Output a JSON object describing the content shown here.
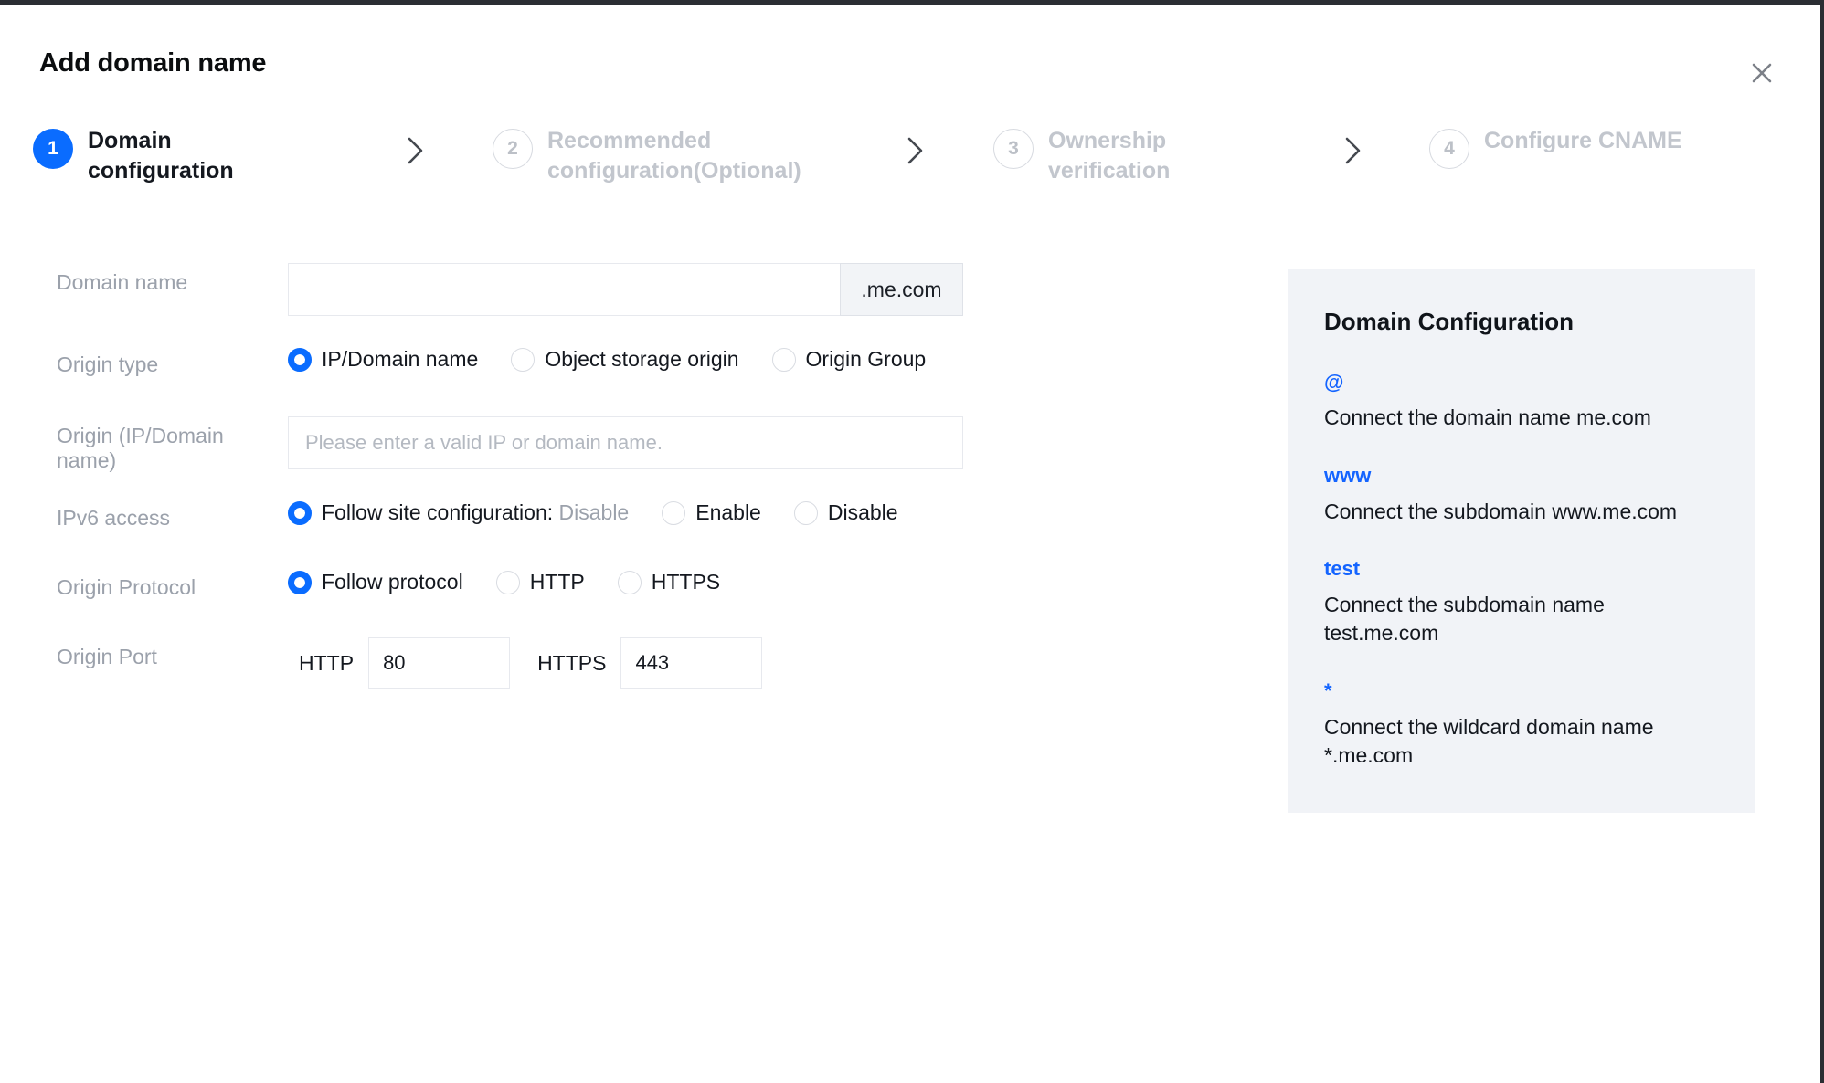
{
  "dialog": {
    "title": "Add domain name",
    "close_icon": "close-icon"
  },
  "stepper": {
    "steps": [
      {
        "number": "1",
        "label": "Domain configuration",
        "state": "active"
      },
      {
        "number": "2",
        "label": "Recommended configuration(Optional)",
        "state": "inactive"
      },
      {
        "number": "3",
        "label": "Ownership verification",
        "state": "inactive"
      },
      {
        "number": "4",
        "label": "Configure CNAME",
        "state": "inactive"
      }
    ],
    "separator_icon": "chevron-right-icon"
  },
  "form": {
    "domain_name": {
      "label": "Domain name",
      "value": "",
      "placeholder": "",
      "suffix": ".me.com"
    },
    "origin_type": {
      "label": "Origin type",
      "options": [
        {
          "label": "IP/Domain name",
          "selected": true
        },
        {
          "label": "Object storage origin",
          "selected": false
        },
        {
          "label": "Origin Group",
          "selected": false
        }
      ]
    },
    "origin_address": {
      "label": "Origin (IP/Domain name)",
      "value": "",
      "placeholder": "Please enter a valid IP or domain name."
    },
    "ipv6_access": {
      "label": "IPv6 access",
      "options": [
        {
          "label": "Follow site configuration:",
          "suffix": "Disable",
          "selected": true
        },
        {
          "label": "Enable",
          "selected": false
        },
        {
          "label": "Disable",
          "selected": false
        }
      ]
    },
    "origin_protocol": {
      "label": "Origin Protocol",
      "options": [
        {
          "label": "Follow protocol",
          "selected": true
        },
        {
          "label": "HTTP",
          "selected": false
        },
        {
          "label": "HTTPS",
          "selected": false
        }
      ]
    },
    "origin_port": {
      "label": "Origin Port",
      "http_label": "HTTP",
      "http_value": "80",
      "https_label": "HTTPS",
      "https_value": "443"
    }
  },
  "side_panel": {
    "title": "Domain Configuration",
    "items": [
      {
        "key": "@",
        "desc": "Connect the domain name me.com"
      },
      {
        "key": "www",
        "desc": "Connect the subdomain www.me.com"
      },
      {
        "key": "test",
        "desc": "Connect the subdomain name test.me.com"
      },
      {
        "key": "*",
        "desc": "Connect the wildcard domain name *.me.com"
      }
    ]
  },
  "colors": {
    "accent": "#0a6cff",
    "link": "#1464ff",
    "panel_bg": "#f1f3f7",
    "muted_text": "#9ba1ab",
    "inactive_step": "#c2c6cd"
  }
}
